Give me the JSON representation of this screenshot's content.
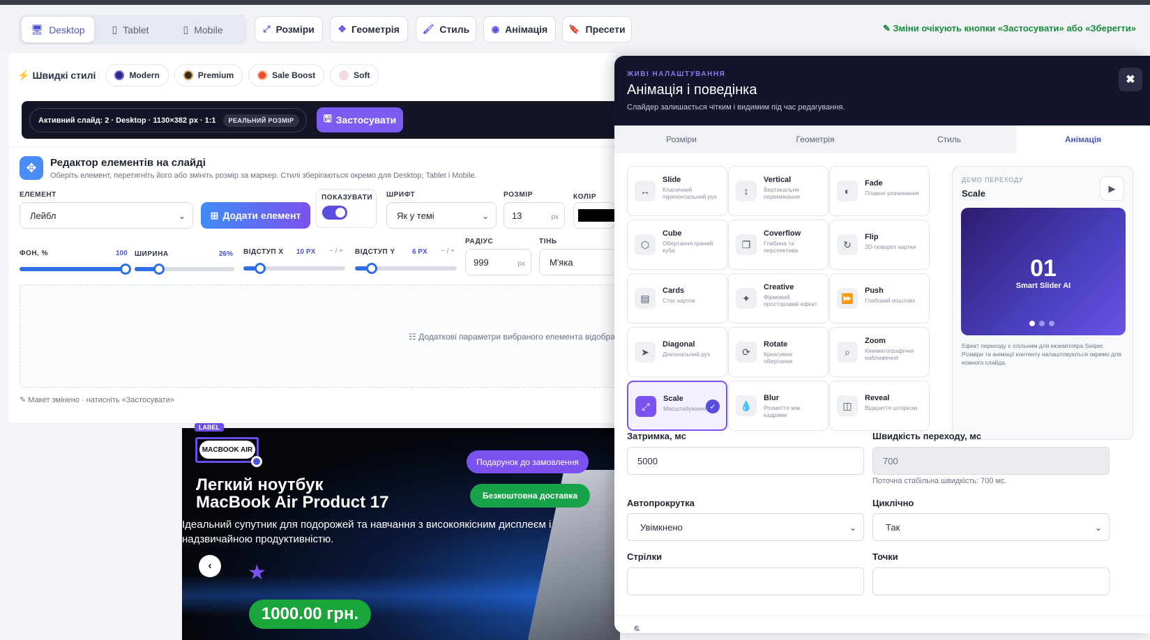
{
  "toolbar": {
    "devices": [
      {
        "label": "Desktop",
        "icon": "desktop-icon"
      },
      {
        "label": "Tablet",
        "icon": "tablet-icon"
      },
      {
        "label": "Mobile",
        "icon": "mobile-icon"
      }
    ],
    "tabs": [
      {
        "label": "Розміри",
        "icon": "resize-icon"
      },
      {
        "label": "Геометрія",
        "icon": "move-icon"
      },
      {
        "label": "Стиль",
        "icon": "brush-icon"
      },
      {
        "label": "Анімація",
        "icon": "play-circle-icon"
      },
      {
        "label": "Пресети",
        "icon": "bookmark-icon"
      }
    ],
    "notice": "Зміни очікують кнопки «Застосувати» або «Зберегти»"
  },
  "quick_styles": {
    "label": "Швидкі стилі",
    "items": [
      {
        "label": "Modern",
        "color": "#2b2a8a"
      },
      {
        "label": "Premium",
        "color": "#3a2a1c"
      },
      {
        "label": "Sale Boost",
        "color": "#f04a2a"
      },
      {
        "label": "Soft",
        "color": "#f6d7e6"
      }
    ]
  },
  "active_bar": {
    "info": "Активний слайд: 2 · Desktop · 1130×382 px · 1:1",
    "badge": "РЕАЛЬНИЙ РОЗМІР",
    "apply": "Застосувати"
  },
  "editor": {
    "title": "Редактор елементів на слайді",
    "subtitle": "Оберіть елемент, перетягніть його або змініть розмір за маркер. Стилі зберігаються окремо для Desktop, Tablet і Mobile.",
    "element_label": "ЕЛЕМЕНТ",
    "element_value": "Лейбл",
    "add_button": "Додати елемент",
    "show_label": "ПОКАЗУВАТИ",
    "font_label": "ШРИФТ",
    "font_value": "Як у темі",
    "size_label": "РОЗМІР",
    "size_value": "13",
    "size_unit": "px",
    "color_label": "КОЛІР",
    "bg_label": "ФОН, %",
    "bg_value": "100",
    "width_label": "ШИРИНА",
    "width_value": "26%",
    "offx_label": "ВІДСТУП X",
    "offx_value": "10 PX",
    "offy_label": "ВІДСТУП Y",
    "offy_value": "6 PX",
    "minus_plus": "− / +",
    "radius_label": "РАДІУС",
    "radius_value": "999",
    "radius_unit": "px",
    "shadow_label": "ТІНЬ",
    "shadow_value": "М'яка",
    "extra_text": "Додаткові параметри вибраного елемента відобра",
    "changed_text": "Макет змінено · натисніть «Застосувати»",
    "sliders": {
      "bg": 1.0,
      "width": 0.26,
      "offx": 0.18,
      "offy": 0.18
    }
  },
  "preview": {
    "tag": "LABEL",
    "badge": "MACBOOK AIR",
    "gift": "Подарунок до замовлення",
    "free": "Безкоштовна доставка",
    "title_line1": "Легкий ноутбук",
    "title_line2": "MacBook Air Product 17",
    "description": "Ідеальний супутник для подорожей та навчання з високоякісним дисплеєм і надзвичайною продуктивністю.",
    "price": "1000.00 грн."
  },
  "panel": {
    "kicker": "ЖИВІ НАЛАШТУВАННЯ",
    "title": "Анімація і поведінка",
    "subtitle": "Слайдер залишається чітким і видимим під час редагування.",
    "tabs": [
      "Розміри",
      "Геометрія",
      "Стиль",
      "Анімація"
    ],
    "effects": [
      {
        "name": "Slide",
        "desc": "Класичний горизонтальний рух",
        "icon": "arrows-horizontal-icon",
        "glyph": "↔"
      },
      {
        "name": "Vertical",
        "desc": "Вертикальне перемикання",
        "icon": "arrows-vertical-icon",
        "glyph": "↕"
      },
      {
        "name": "Fade",
        "desc": "Плавне розчинення",
        "icon": "half-circle-icon",
        "glyph": "◐"
      },
      {
        "name": "Cube",
        "desc": "Обертання граней куба",
        "icon": "cube-icon",
        "glyph": "⬡"
      },
      {
        "name": "Coverflow",
        "desc": "Глибина та перспектива",
        "icon": "copy-icon",
        "glyph": "❐"
      },
      {
        "name": "Flip",
        "desc": "3D-поворот картки",
        "icon": "rotate-icon",
        "glyph": "↻"
      },
      {
        "name": "Cards",
        "desc": "Стос карток",
        "icon": "id-card-icon",
        "glyph": "▤"
      },
      {
        "name": "Creative",
        "desc": "Фірмовий просторовий ефект",
        "icon": "magic-wand-icon",
        "glyph": "✦"
      },
      {
        "name": "Push",
        "desc": "Глибокий поштовх",
        "icon": "fast-forward-icon",
        "glyph": "⏩"
      },
      {
        "name": "Diagonal",
        "desc": "Діагональний рух",
        "icon": "location-arrow-icon",
        "glyph": "➤"
      },
      {
        "name": "Rotate",
        "desc": "Креативне обертання",
        "icon": "sync-icon",
        "glyph": "⟳"
      },
      {
        "name": "Zoom",
        "desc": "Кінематографічне наближення",
        "icon": "zoom-icon",
        "glyph": "⌕"
      },
      {
        "name": "Scale",
        "desc": "Масштабування кадру",
        "icon": "expand-icon",
        "glyph": "⤢",
        "selected": true
      },
      {
        "name": "Blur",
        "desc": "Розмиття між кадрами",
        "icon": "droplet-icon",
        "glyph": "💧"
      },
      {
        "name": "Reveal",
        "desc": "Відкриття шторкою",
        "icon": "columns-icon",
        "glyph": "◫"
      }
    ],
    "demo": {
      "kicker": "ДЕМО ПЕРЕХОДУ",
      "name": "Scale",
      "number": "01",
      "brand": "Smart Slider AI",
      "note": "Ефект переходу є спільним для екземпляра Swiper. Розміри та анімації контенту налаштовуються окремо для кожного слайда."
    },
    "delay_label": "Затримка, мс",
    "delay_value": "5000",
    "speed_label": "Швидкість переходу, мс",
    "speed_value": "700",
    "speed_hint": "Поточна стабільна швидкість: 700 мс.",
    "autoplay_label": "Автопрокрутка",
    "autoplay_value": "Увімкнено",
    "loop_label": "Циклічно",
    "loop_value": "Так",
    "arrows_label": "Стрілки",
    "dots_label": "Точки",
    "footer": "Є незастосовані зміни"
  }
}
